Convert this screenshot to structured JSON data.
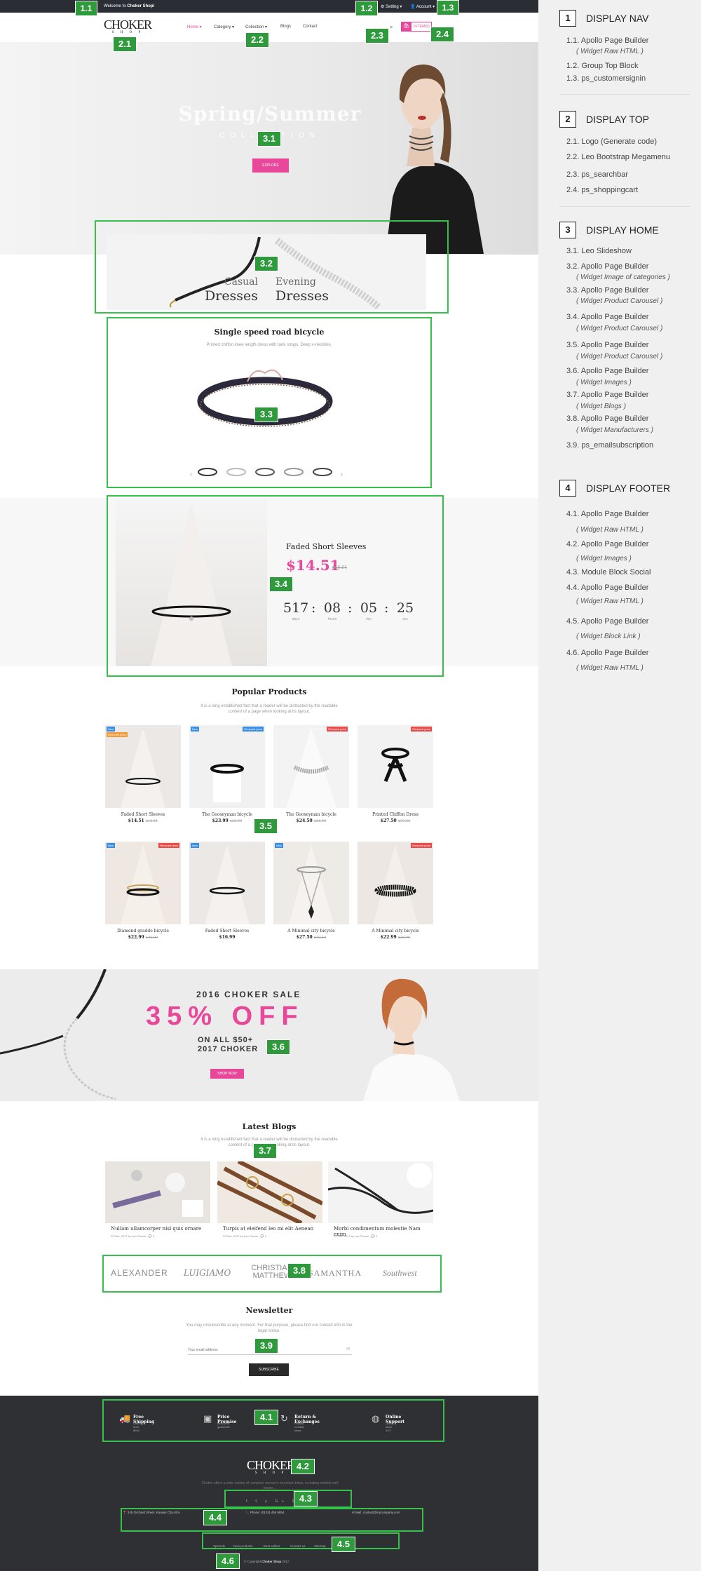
{
  "topbar": {
    "welcome_prefix": "Welcome to ",
    "welcome_shop": "Choker Shop!",
    "setting": "Setting",
    "account": "Account"
  },
  "header": {
    "logo": "CHOKER",
    "logo_sub": "S H O P",
    "menu": [
      "Home",
      "Category",
      "Collection",
      "Blogs",
      "Contact"
    ],
    "cart": "0 ITEM(S)"
  },
  "hero": {
    "title": "Spring/Summer",
    "subtitle": "COLLECTION",
    "button": "EXPLORE"
  },
  "banner": {
    "left_small": "Casual",
    "left_big": "Dresses",
    "right_small": "Evening",
    "right_big": "Dresses"
  },
  "featured": {
    "title": "Single speed road bicycle",
    "desc": "Printed chiffon knee length dress with tank straps. Deep v-neckline."
  },
  "deal": {
    "name": "Faded Short Sleeves",
    "price": "$14.51",
    "old_price": "$16.51",
    "countdown": [
      {
        "value": "517",
        "label": "days"
      },
      {
        "value": "08",
        "label": "hours"
      },
      {
        "value": "05",
        "label": "min"
      },
      {
        "value": "25",
        "label": "sec"
      }
    ]
  },
  "popular": {
    "title": "Popular Products",
    "desc1": "It is a long established fact that a reader will be distracted by the readable",
    "desc2": "content of a page when looking at its layout.",
    "products": [
      {
        "name": "Faded Short Sleeves",
        "price": "$14.51",
        "old": "$16.51",
        "badges": [
          "New",
          "Reduced price"
        ]
      },
      {
        "name": "The Gooseyman bicycle",
        "price": "$23.99",
        "old": "$26.99",
        "badges": [
          "New",
          "Reduced price"
        ]
      },
      {
        "name": "The Gooseyman bicycle",
        "price": "$24.50",
        "old": "$26.99",
        "badges": [
          "Reduced price"
        ]
      },
      {
        "name": "Printed Chiffon Dress",
        "price": "$27.50",
        "old": "$30.50",
        "badges": [
          "Reduced price"
        ]
      },
      {
        "name": "Diamond gradde bicycle",
        "price": "$22.99",
        "old": "$26.99",
        "badges": [
          "New",
          "Reduced price"
        ]
      },
      {
        "name": "Faded Short Sleeves",
        "price": "$16.99",
        "old": "",
        "badges": [
          "New"
        ]
      },
      {
        "name": "A Minimal city bicycle",
        "price": "$27.50",
        "old": "$30.50",
        "badges": [
          "New"
        ]
      },
      {
        "name": "A Minimal city bicycle",
        "price": "$22.99",
        "old": "$26.99",
        "badges": [
          "Reduced price"
        ]
      }
    ]
  },
  "sale": {
    "line1": "2016 CHOKER SALE",
    "line2": "35% OFF",
    "line3": "ON ALL $50+",
    "line4": "2017 CHOKER",
    "button": "SHOP NOW"
  },
  "blogs": {
    "title": "Latest Blogs",
    "desc1": "It is a long established fact that a reader will be distracted by the readable",
    "desc2": "content of a page when looking at its layout.",
    "items": [
      {
        "title": "Nullam ullamcorper nisl quis ornare",
        "meta": "22 Feb, 2017 by Leo Theme",
        "comments": "0"
      },
      {
        "title": "Turpis at eleifend leo mi elit Aenean",
        "meta": "22 Feb, 2017 by Leo Theme",
        "comments": "0"
      },
      {
        "title": "Morbi condimentum molestie Nam enim",
        "meta": "22 Feb, 2017 by Leo Theme",
        "comments": "0"
      }
    ]
  },
  "brands": [
    "ALEXANDER",
    "LUIGIAMO",
    "CHRISTIAN MATTHEW",
    "SAMANTHA",
    "Southwest"
  ],
  "newsletter": {
    "title": "Newsletter",
    "desc1": "You may unsubscribe at any moment. For that purpose, please find our contact info in the",
    "desc2": "legal notice.",
    "placeholder": "Your email address",
    "button": "SUBSCRIBE"
  },
  "footer": {
    "features": [
      {
        "title": "Free Shipping",
        "sub": "Delivery from $200"
      },
      {
        "title": "Price Promise",
        "sub": "Best price guarantee"
      },
      {
        "title": "Return & Exchanges",
        "sub": "Product remains intact"
      },
      {
        "title": "Online Support",
        "sub": "Online since 24/7"
      }
    ],
    "logo": "CHOKER",
    "logo_sub": "S H O P",
    "about1": "Choker offers a wide variety of complete women's mountain bikes, including models well",
    "about2": "known...",
    "social": "f t y G+ P",
    "address": "245 Orchard Street, Kansas City,USA",
    "phone": "Phone: (0123) 456 9654",
    "mail": "Mail: contact@mycompany.com",
    "links": [
      "Specials",
      "New products",
      "Best sellers",
      "Contact us",
      "Sitemap"
    ],
    "copyright_prefix": "© Copyright ",
    "copyright_shop": "Choker Shop",
    "copyright_year": " 2017"
  },
  "annotations": [
    "1.1",
    "1.2",
    "1.3",
    "2.1",
    "2.2",
    "2.3",
    "2.4",
    "3.1",
    "3.2",
    "3.3",
    "3.4",
    "3.5",
    "3.6",
    "3.7",
    "3.8",
    "3.9",
    "4.1",
    "4.2",
    "4.3",
    "4.4",
    "4.5",
    "4.6"
  ],
  "legend": {
    "groups": [
      {
        "num": "1",
        "title": "DISPLAY NAV",
        "items": [
          {
            "label": "1.1. Apollo Page Builder",
            "sub": "( Widget Raw HTML )"
          },
          {
            "label": "1.2. Group Top Block"
          },
          {
            "label": "1.3. ps_customersignin"
          }
        ]
      },
      {
        "num": "2",
        "title": "DISPLAY TOP",
        "items": [
          {
            "label": "2.1. Logo (Generate code)"
          },
          {
            "label": "2.2. Leo Bootstrap Megamenu"
          },
          {
            "label": "2.3. ps_searchbar"
          },
          {
            "label": "2.4. ps_shoppingcart"
          }
        ]
      },
      {
        "num": "3",
        "title": "DISPLAY HOME",
        "items": [
          {
            "label": "3.1. Leo Slideshow"
          },
          {
            "label": "3.2. Apollo Page Builder",
            "sub": "( Widget Image of  categories )"
          },
          {
            "label": "3.3. Apollo Page Builder",
            "sub": "( Widget Product Carousel )"
          },
          {
            "label": "3.4. Apollo Page Builder",
            "sub": "( Widget Product Carousel )"
          },
          {
            "label": "3.5. Apollo Page Builder",
            "sub": "( Widget Product Carousel )"
          },
          {
            "label": "3.6. Apollo Page Builder",
            "sub": "( Widget Images )"
          },
          {
            "label": "3.7. Apollo Page Builder",
            "sub": "( Widget Blogs )"
          },
          {
            "label": "3.8. Apollo Page Builder",
            "sub": "( Widget Manufacturers )"
          },
          {
            "label": "3.9. ps_emailsubscription"
          }
        ]
      },
      {
        "num": "4",
        "title": "DISPLAY FOOTER",
        "items": [
          {
            "label": "4.1. Apollo Page Builder",
            "sub": "( Widget Raw HTML )"
          },
          {
            "label": "4.2. Apollo Page Builder",
            "sub": "( Widget Images )"
          },
          {
            "label": "4.3. Module Block Social"
          },
          {
            "label": "4.4. Apollo Page Builder",
            "sub": "( Widget Raw HTML )"
          },
          {
            "label": "4.5. Apollo Page Builder",
            "sub": "( Widget Block Link )"
          },
          {
            "label": "4.6. Apollo Page Builder",
            "sub": "( Widget Raw HTML )"
          }
        ]
      }
    ]
  },
  "colors": {
    "accent": "#e9489a",
    "annotation": "#36c14d",
    "footer": "#2f3033",
    "topbar": "#2a2d34"
  }
}
